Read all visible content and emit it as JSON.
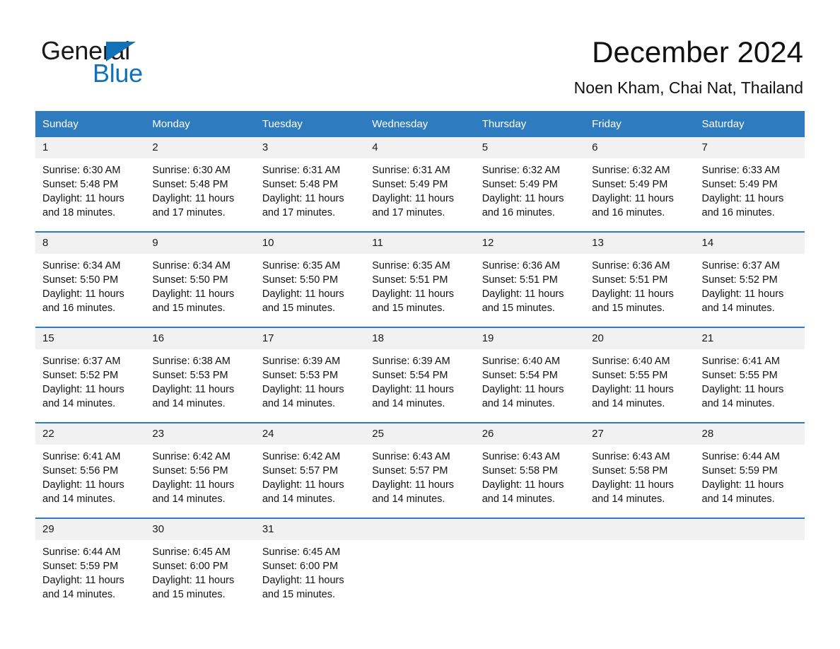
{
  "brand": {
    "name_dark": "General",
    "name_light": "Blue",
    "triangle_color": "#1272b9"
  },
  "header": {
    "month_title": "December 2024",
    "location": "Noen Kham, Chai Nat, Thailand"
  },
  "theme": {
    "header_blue": "#2e7cbf",
    "daynum_band": "#f1f1f1",
    "text": "#111111"
  },
  "calendar": {
    "weekday_headers": [
      "Sunday",
      "Monday",
      "Tuesday",
      "Wednesday",
      "Thursday",
      "Friday",
      "Saturday"
    ],
    "weeks": [
      [
        {
          "day": "1",
          "sunrise": "Sunrise: 6:30 AM",
          "sunset": "Sunset: 5:48 PM",
          "daylight": "Daylight: 11 hours and 18 minutes."
        },
        {
          "day": "2",
          "sunrise": "Sunrise: 6:30 AM",
          "sunset": "Sunset: 5:48 PM",
          "daylight": "Daylight: 11 hours and 17 minutes."
        },
        {
          "day": "3",
          "sunrise": "Sunrise: 6:31 AM",
          "sunset": "Sunset: 5:48 PM",
          "daylight": "Daylight: 11 hours and 17 minutes."
        },
        {
          "day": "4",
          "sunrise": "Sunrise: 6:31 AM",
          "sunset": "Sunset: 5:49 PM",
          "daylight": "Daylight: 11 hours and 17 minutes."
        },
        {
          "day": "5",
          "sunrise": "Sunrise: 6:32 AM",
          "sunset": "Sunset: 5:49 PM",
          "daylight": "Daylight: 11 hours and 16 minutes."
        },
        {
          "day": "6",
          "sunrise": "Sunrise: 6:32 AM",
          "sunset": "Sunset: 5:49 PM",
          "daylight": "Daylight: 11 hours and 16 minutes."
        },
        {
          "day": "7",
          "sunrise": "Sunrise: 6:33 AM",
          "sunset": "Sunset: 5:49 PM",
          "daylight": "Daylight: 11 hours and 16 minutes."
        }
      ],
      [
        {
          "day": "8",
          "sunrise": "Sunrise: 6:34 AM",
          "sunset": "Sunset: 5:50 PM",
          "daylight": "Daylight: 11 hours and 16 minutes."
        },
        {
          "day": "9",
          "sunrise": "Sunrise: 6:34 AM",
          "sunset": "Sunset: 5:50 PM",
          "daylight": "Daylight: 11 hours and 15 minutes."
        },
        {
          "day": "10",
          "sunrise": "Sunrise: 6:35 AM",
          "sunset": "Sunset: 5:50 PM",
          "daylight": "Daylight: 11 hours and 15 minutes."
        },
        {
          "day": "11",
          "sunrise": "Sunrise: 6:35 AM",
          "sunset": "Sunset: 5:51 PM",
          "daylight": "Daylight: 11 hours and 15 minutes."
        },
        {
          "day": "12",
          "sunrise": "Sunrise: 6:36 AM",
          "sunset": "Sunset: 5:51 PM",
          "daylight": "Daylight: 11 hours and 15 minutes."
        },
        {
          "day": "13",
          "sunrise": "Sunrise: 6:36 AM",
          "sunset": "Sunset: 5:51 PM",
          "daylight": "Daylight: 11 hours and 15 minutes."
        },
        {
          "day": "14",
          "sunrise": "Sunrise: 6:37 AM",
          "sunset": "Sunset: 5:52 PM",
          "daylight": "Daylight: 11 hours and 14 minutes."
        }
      ],
      [
        {
          "day": "15",
          "sunrise": "Sunrise: 6:37 AM",
          "sunset": "Sunset: 5:52 PM",
          "daylight": "Daylight: 11 hours and 14 minutes."
        },
        {
          "day": "16",
          "sunrise": "Sunrise: 6:38 AM",
          "sunset": "Sunset: 5:53 PM",
          "daylight": "Daylight: 11 hours and 14 minutes."
        },
        {
          "day": "17",
          "sunrise": "Sunrise: 6:39 AM",
          "sunset": "Sunset: 5:53 PM",
          "daylight": "Daylight: 11 hours and 14 minutes."
        },
        {
          "day": "18",
          "sunrise": "Sunrise: 6:39 AM",
          "sunset": "Sunset: 5:54 PM",
          "daylight": "Daylight: 11 hours and 14 minutes."
        },
        {
          "day": "19",
          "sunrise": "Sunrise: 6:40 AM",
          "sunset": "Sunset: 5:54 PM",
          "daylight": "Daylight: 11 hours and 14 minutes."
        },
        {
          "day": "20",
          "sunrise": "Sunrise: 6:40 AM",
          "sunset": "Sunset: 5:55 PM",
          "daylight": "Daylight: 11 hours and 14 minutes."
        },
        {
          "day": "21",
          "sunrise": "Sunrise: 6:41 AM",
          "sunset": "Sunset: 5:55 PM",
          "daylight": "Daylight: 11 hours and 14 minutes."
        }
      ],
      [
        {
          "day": "22",
          "sunrise": "Sunrise: 6:41 AM",
          "sunset": "Sunset: 5:56 PM",
          "daylight": "Daylight: 11 hours and 14 minutes."
        },
        {
          "day": "23",
          "sunrise": "Sunrise: 6:42 AM",
          "sunset": "Sunset: 5:56 PM",
          "daylight": "Daylight: 11 hours and 14 minutes."
        },
        {
          "day": "24",
          "sunrise": "Sunrise: 6:42 AM",
          "sunset": "Sunset: 5:57 PM",
          "daylight": "Daylight: 11 hours and 14 minutes."
        },
        {
          "day": "25",
          "sunrise": "Sunrise: 6:43 AM",
          "sunset": "Sunset: 5:57 PM",
          "daylight": "Daylight: 11 hours and 14 minutes."
        },
        {
          "day": "26",
          "sunrise": "Sunrise: 6:43 AM",
          "sunset": "Sunset: 5:58 PM",
          "daylight": "Daylight: 11 hours and 14 minutes."
        },
        {
          "day": "27",
          "sunrise": "Sunrise: 6:43 AM",
          "sunset": "Sunset: 5:58 PM",
          "daylight": "Daylight: 11 hours and 14 minutes."
        },
        {
          "day": "28",
          "sunrise": "Sunrise: 6:44 AM",
          "sunset": "Sunset: 5:59 PM",
          "daylight": "Daylight: 11 hours and 14 minutes."
        }
      ],
      [
        {
          "day": "29",
          "sunrise": "Sunrise: 6:44 AM",
          "sunset": "Sunset: 5:59 PM",
          "daylight": "Daylight: 11 hours and 14 minutes."
        },
        {
          "day": "30",
          "sunrise": "Sunrise: 6:45 AM",
          "sunset": "Sunset: 6:00 PM",
          "daylight": "Daylight: 11 hours and 15 minutes."
        },
        {
          "day": "31",
          "sunrise": "Sunrise: 6:45 AM",
          "sunset": "Sunset: 6:00 PM",
          "daylight": "Daylight: 11 hours and 15 minutes."
        },
        {
          "day": "",
          "sunrise": "",
          "sunset": "",
          "daylight": ""
        },
        {
          "day": "",
          "sunrise": "",
          "sunset": "",
          "daylight": ""
        },
        {
          "day": "",
          "sunrise": "",
          "sunset": "",
          "daylight": ""
        },
        {
          "day": "",
          "sunrise": "",
          "sunset": "",
          "daylight": ""
        }
      ]
    ]
  }
}
